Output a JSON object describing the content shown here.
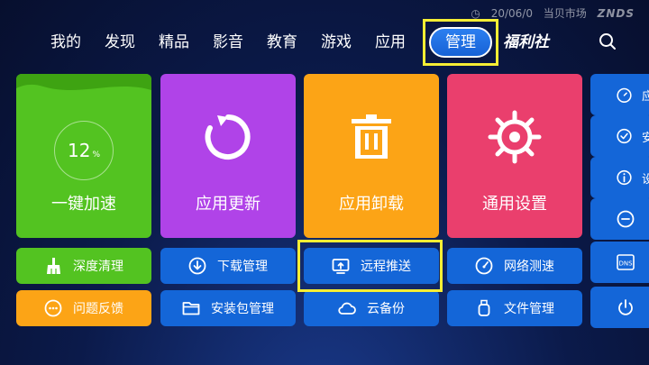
{
  "status": {
    "time": "20/06/0",
    "watermark": "当贝市场",
    "brand": "ZNDS"
  },
  "nav": {
    "items": [
      "我的",
      "发现",
      "精品",
      "影音",
      "教育",
      "游戏",
      "应用"
    ],
    "active": "管理",
    "fuli": "福利社"
  },
  "tiles": {
    "speedup": {
      "label": "一键加速",
      "percent": "12",
      "unit": "%"
    },
    "update": {
      "label": "应用更新"
    },
    "uninstall": {
      "label": "应用卸载"
    },
    "settings": {
      "label": "通用设置"
    }
  },
  "shortcuts": {
    "row1": [
      "深度清理",
      "下载管理",
      "远程推送",
      "网络测速"
    ],
    "row2": [
      "问题反馈",
      "安装包管理",
      "云备份",
      "文件管理"
    ]
  },
  "side": {
    "item1_text": "应",
    "item2_text": "安",
    "item3_text": "设",
    "item4_text": "",
    "item5_text": "",
    "item6_text": "",
    "dns_label": "DNS"
  },
  "colors": {
    "green": "#53c321",
    "purple": "#b043e8",
    "orange": "#fca416",
    "pink": "#ea3f6d",
    "blue": "#1466d8",
    "highlight": "#f6ee34"
  }
}
